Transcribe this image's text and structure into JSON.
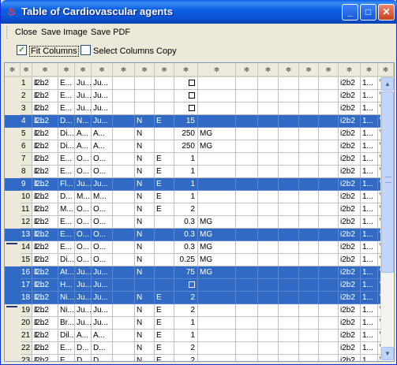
{
  "window": {
    "title": "Table of Cardiovascular agents",
    "icon": "java-cup-icon",
    "controls": {
      "minimize": "_",
      "maximize": "□",
      "close": "✕"
    }
  },
  "menubar": {
    "close": "Close",
    "save_image": "Save Image",
    "save_pdf": "Save PDF"
  },
  "toolbar": {
    "fit_columns": {
      "label": "Fit Columns",
      "checked": true
    },
    "select_columns": {
      "label": "Select Columns",
      "checked": false
    },
    "copy": "Copy"
  },
  "table": {
    "header_glyph": "≑",
    "columns": 18,
    "rows": [
      {
        "n": "1",
        "c": [
          "i2b2",
          "1...",
          "E...",
          "Ju...",
          "Ju...",
          "",
          "",
          "",
          "□",
          "",
          "",
          "",
          "",
          "",
          "",
          "i2b2",
          "1...",
          "\\\\i..."
        ],
        "sel": false
      },
      {
        "n": "2",
        "c": [
          "i2b2",
          "1...",
          "E...",
          "Ju...",
          "Ju...",
          "",
          "",
          "",
          "□",
          "",
          "",
          "",
          "",
          "",
          "",
          "i2b2",
          "1...",
          "\\\\i..."
        ],
        "sel": false
      },
      {
        "n": "3",
        "c": [
          "i2b2",
          "1...",
          "E...",
          "Ju...",
          "Ju...",
          "",
          "",
          "",
          "□",
          "",
          "",
          "",
          "",
          "",
          "",
          "i2b2",
          "1...",
          "\\\\i..."
        ],
        "sel": false
      },
      {
        "n": "4",
        "c": [
          "i2b2",
          "1...",
          "D...",
          "N...",
          "Ju...",
          "",
          "N",
          "E",
          "15",
          "",
          "",
          "",
          "",
          "",
          "",
          "i2b2",
          "1...",
          "\\\\i..."
        ],
        "sel": true
      },
      {
        "n": "5",
        "c": [
          "i2b2",
          "1...",
          "Di...",
          "A...",
          "A...",
          "",
          "N",
          "",
          "250",
          "MG",
          "",
          "",
          "",
          "",
          "",
          "i2b2",
          "1...",
          "\\\\i..."
        ],
        "sel": false
      },
      {
        "n": "6",
        "c": [
          "i2b2",
          "1...",
          "Di...",
          "A...",
          "A...",
          "",
          "N",
          "",
          "250",
          "MG",
          "",
          "",
          "",
          "",
          "",
          "i2b2",
          "1...",
          "\\\\i..."
        ],
        "sel": false
      },
      {
        "n": "7",
        "c": [
          "i2b2",
          "1...",
          "E...",
          "O...",
          "O...",
          "",
          "N",
          "E",
          "1",
          "",
          "",
          "",
          "",
          "",
          "",
          "i2b2",
          "1...",
          "\\\\i..."
        ],
        "sel": false
      },
      {
        "n": "8",
        "c": [
          "i2b2",
          "1...",
          "E...",
          "O...",
          "O...",
          "",
          "N",
          "E",
          "1",
          "",
          "",
          "",
          "",
          "",
          "",
          "i2b2",
          "1...",
          "\\\\i..."
        ],
        "sel": false
      },
      {
        "n": "9",
        "c": [
          "i2b2",
          "1...",
          "Fl...",
          "Ju...",
          "Ju...",
          "",
          "N",
          "E",
          "1",
          "",
          "",
          "",
          "",
          "",
          "",
          "i2b2",
          "1...",
          "\\\\i..."
        ],
        "sel": true
      },
      {
        "n": "10",
        "c": [
          "i2b2",
          "1...",
          "D...",
          "M...",
          "M...",
          "",
          "N",
          "E",
          "1",
          "",
          "",
          "",
          "",
          "",
          "",
          "i2b2",
          "1...",
          "\\\\i..."
        ],
        "sel": false
      },
      {
        "n": "11",
        "c": [
          "i2b2",
          "1...",
          "M...",
          "O...",
          "O...",
          "",
          "N",
          "E",
          "2",
          "",
          "",
          "",
          "",
          "",
          "",
          "i2b2",
          "1...",
          "\\\\i..."
        ],
        "sel": false
      },
      {
        "n": "12",
        "c": [
          "i2b2",
          "1...",
          "E...",
          "O...",
          "O...",
          "",
          "N",
          "",
          "0.3",
          "MG",
          "",
          "",
          "",
          "",
          "",
          "i2b2",
          "1...",
          "\\\\i..."
        ],
        "sel": false
      },
      {
        "n": "13",
        "c": [
          "i2b2",
          "1...",
          "E...",
          "O...",
          "O...",
          "",
          "N",
          "",
          "0.3",
          "MG",
          "",
          "",
          "",
          "",
          "",
          "i2b2",
          "1...",
          "\\\\i..."
        ],
        "sel": true
      },
      {
        "n": "14",
        "c": [
          "i2b2",
          "1...",
          "E...",
          "O...",
          "O...",
          "",
          "N",
          "",
          "0.3",
          "MG",
          "",
          "",
          "",
          "",
          "",
          "i2b2",
          "1...",
          "\\\\i..."
        ],
        "sel": false
      },
      {
        "n": "15",
        "c": [
          "i2b2",
          "1...",
          "Di...",
          "O...",
          "O...",
          "",
          "N",
          "",
          "0.25",
          "MG",
          "",
          "",
          "",
          "",
          "",
          "i2b2",
          "1...",
          "\\\\i..."
        ],
        "sel": false
      },
      {
        "n": "16",
        "c": [
          "i2b2",
          "1...",
          "At...",
          "Ju...",
          "Ju...",
          "",
          "N",
          "",
          "75",
          "MG",
          "",
          "",
          "",
          "",
          "",
          "i2b2",
          "1...",
          "\\\\i..."
        ],
        "sel": true
      },
      {
        "n": "17",
        "c": [
          "i2b2",
          "1...",
          "H...",
          "Ju...",
          "Ju...",
          "",
          "",
          "",
          "□",
          "",
          "",
          "",
          "",
          "",
          "",
          "i2b2",
          "1...",
          "\\\\i..."
        ],
        "sel": true
      },
      {
        "n": "18",
        "c": [
          "i2b2",
          "1...",
          "Ni...",
          "Ju...",
          "Ju...",
          "",
          "N",
          "E",
          "2",
          "",
          "",
          "",
          "",
          "",
          "",
          "i2b2",
          "1...",
          "\\\\i..."
        ],
        "sel": true
      },
      {
        "n": "19",
        "c": [
          "i2b2",
          "1...",
          "Ni...",
          "Ju...",
          "Ju...",
          "",
          "N",
          "E",
          "2",
          "",
          "",
          "",
          "",
          "",
          "",
          "i2b2",
          "1...",
          "\\\\i..."
        ],
        "sel": false
      },
      {
        "n": "20",
        "c": [
          "i2b2",
          "1...",
          "Br...",
          "Ju...",
          "Ju...",
          "",
          "N",
          "E",
          "1",
          "",
          "",
          "",
          "",
          "",
          "",
          "i2b2",
          "1...",
          "\\\\i..."
        ],
        "sel": false
      },
      {
        "n": "21",
        "c": [
          "i2b2",
          "1...",
          "Dil...",
          "A...",
          "A...",
          "",
          "N",
          "E",
          "1",
          "",
          "",
          "",
          "",
          "",
          "",
          "i2b2",
          "1...",
          "\\\\i..."
        ],
        "sel": false
      },
      {
        "n": "22",
        "c": [
          "i2b2",
          "1...",
          "E...",
          "D...",
          "D...",
          "",
          "N",
          "E",
          "2",
          "",
          "",
          "",
          "",
          "",
          "",
          "i2b2",
          "1...",
          "\\\\i..."
        ],
        "sel": false
      },
      {
        "n": "23",
        "c": [
          "i2b2",
          "1...",
          "E...",
          "D...",
          "D...",
          "",
          "N",
          "E",
          "2",
          "",
          "",
          "",
          "",
          "",
          "",
          "i2b2",
          "1...",
          "\\\\i..."
        ],
        "sel": false
      }
    ]
  },
  "colors": {
    "selection": "#316ac5",
    "titlebar": "#0a55d8"
  }
}
